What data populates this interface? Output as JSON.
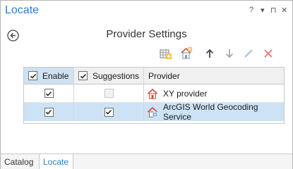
{
  "pane": {
    "title": "Locate",
    "help_label": "?",
    "menu_label": "▾",
    "pin_label": "⊓",
    "close_label": "✕"
  },
  "heading": "Provider Settings",
  "toolbar": {
    "icons": [
      "add-locator-icon",
      "add-provider-icon",
      "move-up-icon",
      "move-down-icon",
      "edit-icon",
      "remove-icon"
    ]
  },
  "grid": {
    "columns": [
      "Enable",
      "Suggestions",
      "Provider"
    ],
    "header_enable_checked": true,
    "header_suggestions_checked": true,
    "rows": [
      {
        "enable": true,
        "suggestions": false,
        "suggestions_disabled": true,
        "provider": "XY provider",
        "icon": "xy-provider-icon",
        "selected": false
      },
      {
        "enable": true,
        "suggestions": true,
        "suggestions_disabled": false,
        "provider": "ArcGIS World Geocoding Service",
        "icon": "geocode-service-icon",
        "selected": true
      }
    ]
  },
  "tabs": [
    {
      "label": "Catalog",
      "active": false
    },
    {
      "label": "Locate",
      "active": true
    }
  ],
  "colors": {
    "accent": "#2e7fc9",
    "selected_row": "#cde3f5",
    "remove": "#e47c7c"
  }
}
